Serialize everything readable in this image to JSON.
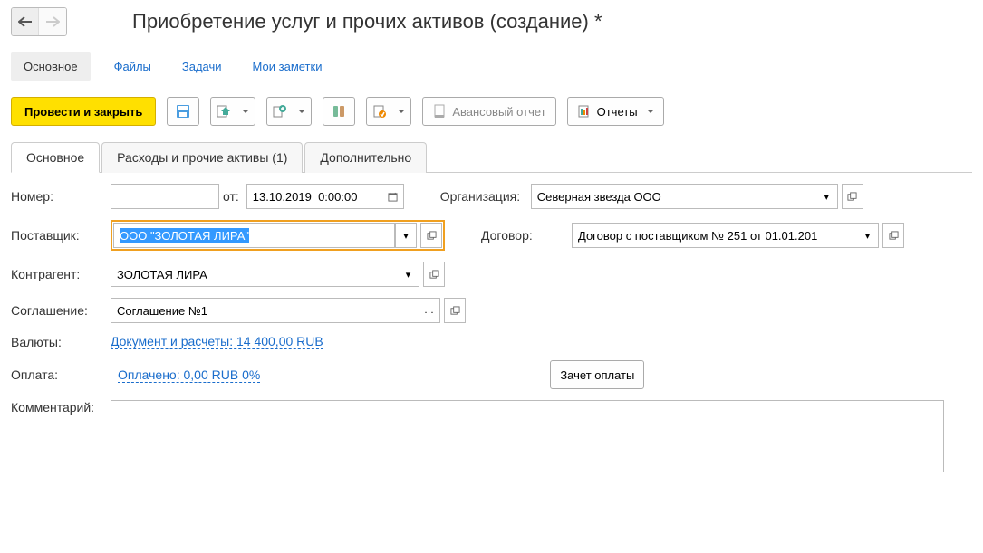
{
  "title": "Приобретение услуг и прочих активов (создание) *",
  "topTabs": {
    "main": "Основное",
    "files": "Файлы",
    "tasks": "Задачи",
    "notes": "Мои заметки"
  },
  "toolbar": {
    "primary": "Провести и закрыть",
    "advanceReport": "Авансовый отчет",
    "reports": "Отчеты"
  },
  "tabs": {
    "main": "Основное",
    "expenses": "Расходы и прочие активы (1)",
    "additional": "Дополнительно"
  },
  "fields": {
    "numberLabel": "Номер:",
    "numberValue": "",
    "fromLabel": "от:",
    "dateValue": "13.10.2019  0:00:00",
    "orgLabel": "Организация:",
    "orgValue": "Северная звезда ООО",
    "supplierLabel": "Поставщик:",
    "supplierValue": "ООО \"ЗОЛОТАЯ ЛИРА\"",
    "contractLabel": "Договор:",
    "contractValue": "Договор с поставщиком № 251 от 01.01.201",
    "contragentLabel": "Контрагент:",
    "contragentValue": "ЗОЛОТАЯ ЛИРА",
    "agreementLabel": "Соглашение:",
    "agreementValue": "Соглашение №1",
    "currencyLabel": "Валюты:",
    "currencyLink": "Документ и расчеты: 14 400,00 RUB",
    "paymentLabel": "Оплата:",
    "paymentLink": "Оплачено: 0,00 RUB  0%",
    "paymentOffset": "Зачет оплаты",
    "commentLabel": "Комментарий:",
    "commentValue": ""
  }
}
